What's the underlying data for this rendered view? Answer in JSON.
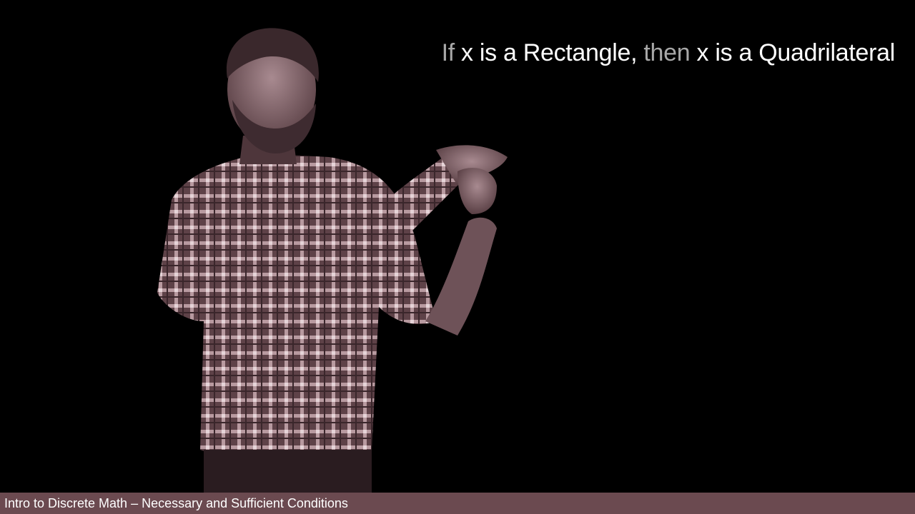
{
  "headline": {
    "if_word": "If",
    "clause_one": " x is a Rectangle, ",
    "then_word": "then",
    "clause_two": " x is a Quadrilateral"
  },
  "caption": {
    "text": "Intro to Discrete Math – Necessary and Sufficient Conditions"
  },
  "colors": {
    "background": "#000000",
    "caption_bar": "#6b4a50",
    "headline_text": "#ffffff",
    "keyword_text": "#a8a8a8",
    "presenter_tint": "#7a5a60"
  }
}
